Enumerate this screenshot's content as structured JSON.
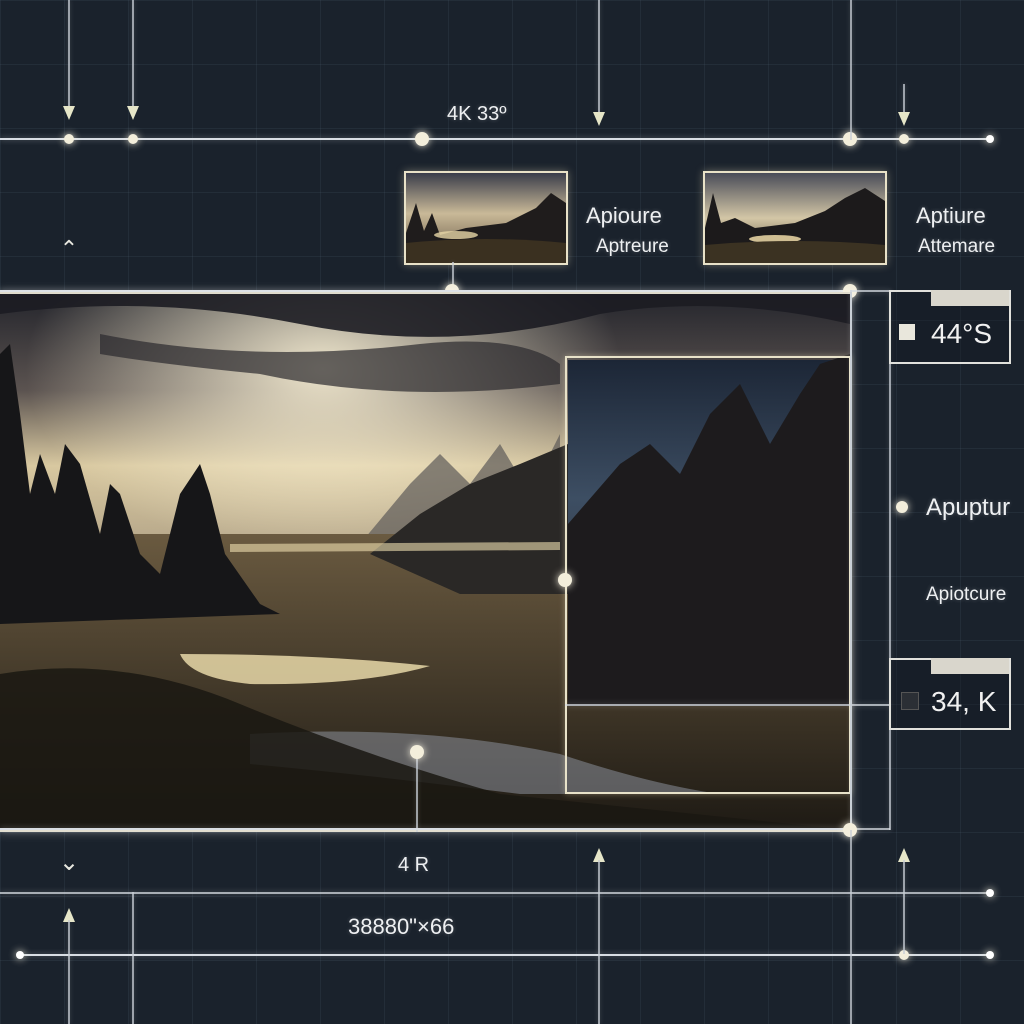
{
  "top_label": "4K 33º",
  "thumbnails": [
    {
      "caption_primary": "Apioure",
      "caption_secondary": "Aptreure"
    },
    {
      "caption_primary": "Aptiure",
      "caption_secondary": "Attemare"
    }
  ],
  "side_readouts": {
    "top_value": "44°S",
    "middle_primary": "Apuptur",
    "middle_secondary": "Apiotcure",
    "bottom_value": "34, K"
  },
  "bottom_labels": {
    "center_value": "4 R",
    "resolution": "38880\"×66"
  },
  "colors": {
    "background": "#1a222c",
    "frame": "#e0dccd",
    "accent_glow": "#f3eedb"
  }
}
